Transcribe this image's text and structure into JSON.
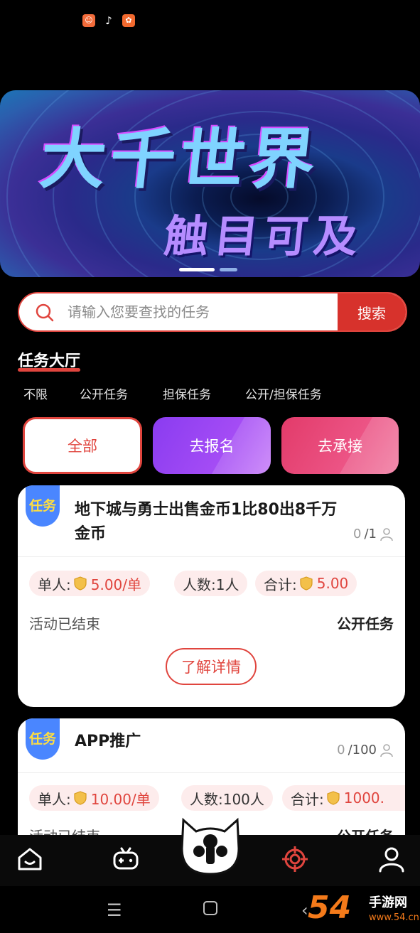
{
  "banner": {
    "title": "大千世界",
    "subtitle": "触目可及"
  },
  "search": {
    "placeholder": "请输入您要查找的任务",
    "button_label": "搜索"
  },
  "section": {
    "title": "任务大厅"
  },
  "filter_tabs": [
    "不限",
    "公开任务",
    "担保任务",
    "公开/担保任务"
  ],
  "categories": {
    "all": "全部",
    "signup": "去报名",
    "accept": "去承接"
  },
  "tasks": [
    {
      "badge": "任务",
      "title": "地下城与勇士出售金币1比80出8千万金币",
      "done": "0",
      "total": "/1",
      "per_person_label": "单人:",
      "per_person_value": "5.00/单",
      "people": "人数:1人",
      "total_label": "合计:",
      "total_value": "5.00",
      "status": "活动已结束",
      "type": "公开任务",
      "detail_label": "了解详情"
    },
    {
      "badge": "任务",
      "title": "APP推广",
      "done": "0",
      "total": "/100",
      "per_person_label": "单人:",
      "per_person_value": "10.00/单",
      "people": "人数:100人",
      "total_label": "合计:",
      "total_value": "1000.",
      "status": "活动已结束",
      "type": "公开任务"
    }
  ],
  "watermark": {
    "number": "54",
    "site": "手游网",
    "url": "www.54.cn"
  },
  "colors": {
    "accent": "#e0453e",
    "purple": "#a44cf5",
    "pink": "#ec5485",
    "badge_blue": "#4a86ff"
  }
}
